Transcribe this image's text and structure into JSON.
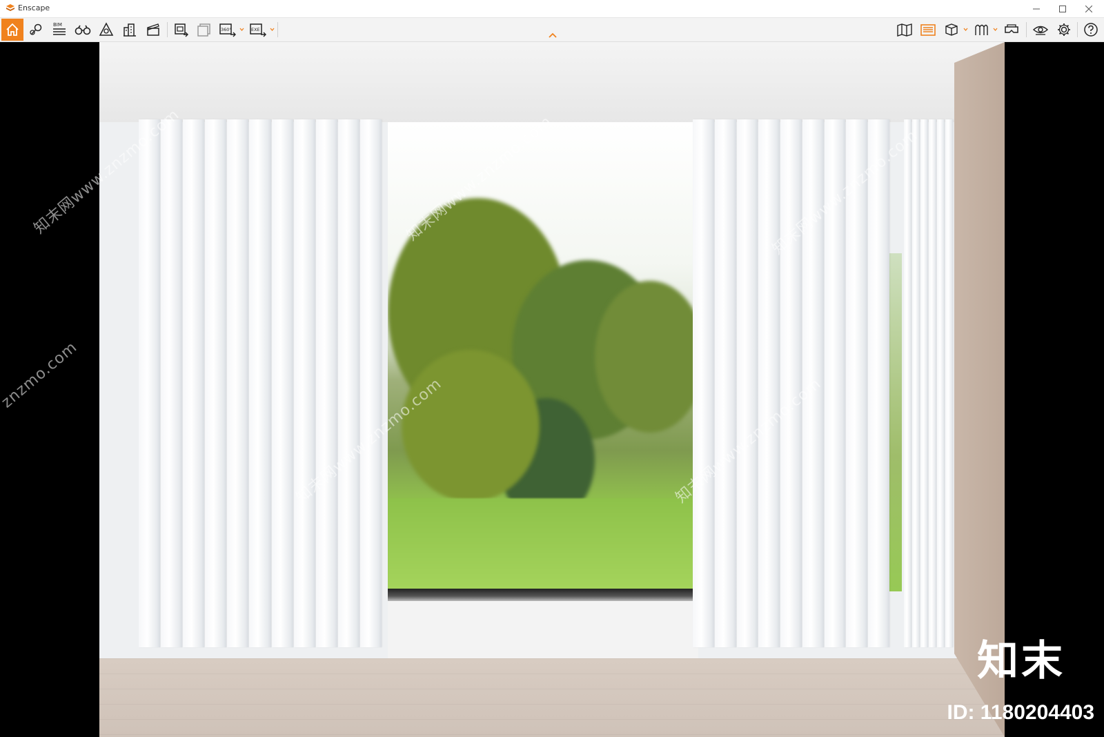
{
  "window": {
    "title": "Enscape"
  },
  "toolbar": {
    "left_tools": [
      {
        "name": "home-icon",
        "active": true
      },
      {
        "name": "location-icon"
      },
      {
        "name": "bim-icon",
        "label": "BIM"
      },
      {
        "name": "binoculars-icon"
      },
      {
        "name": "atmosphere-icon"
      },
      {
        "name": "buildings-icon"
      },
      {
        "name": "clapper-icon"
      },
      {
        "name": "screenshot-icon"
      },
      {
        "name": "batch-render-icon"
      },
      {
        "name": "panorama-360-icon",
        "label": "360°"
      },
      {
        "name": "export-exe-icon",
        "label": "EXE"
      }
    ],
    "right_tools": [
      {
        "name": "map-icon"
      },
      {
        "name": "asset-library-icon"
      },
      {
        "name": "view-cube-icon"
      },
      {
        "name": "material-icon"
      },
      {
        "name": "vr-headset-icon"
      },
      {
        "name": "visual-settings-icon"
      },
      {
        "name": "gear-icon"
      },
      {
        "name": "help-icon"
      }
    ],
    "accent_color": "#f0821e"
  },
  "watermarks": [
    "知末网www.znzmo.com",
    "znzmo.com"
  ],
  "brand": {
    "logo_text": "知末",
    "id_text": "ID: 1180204403"
  }
}
